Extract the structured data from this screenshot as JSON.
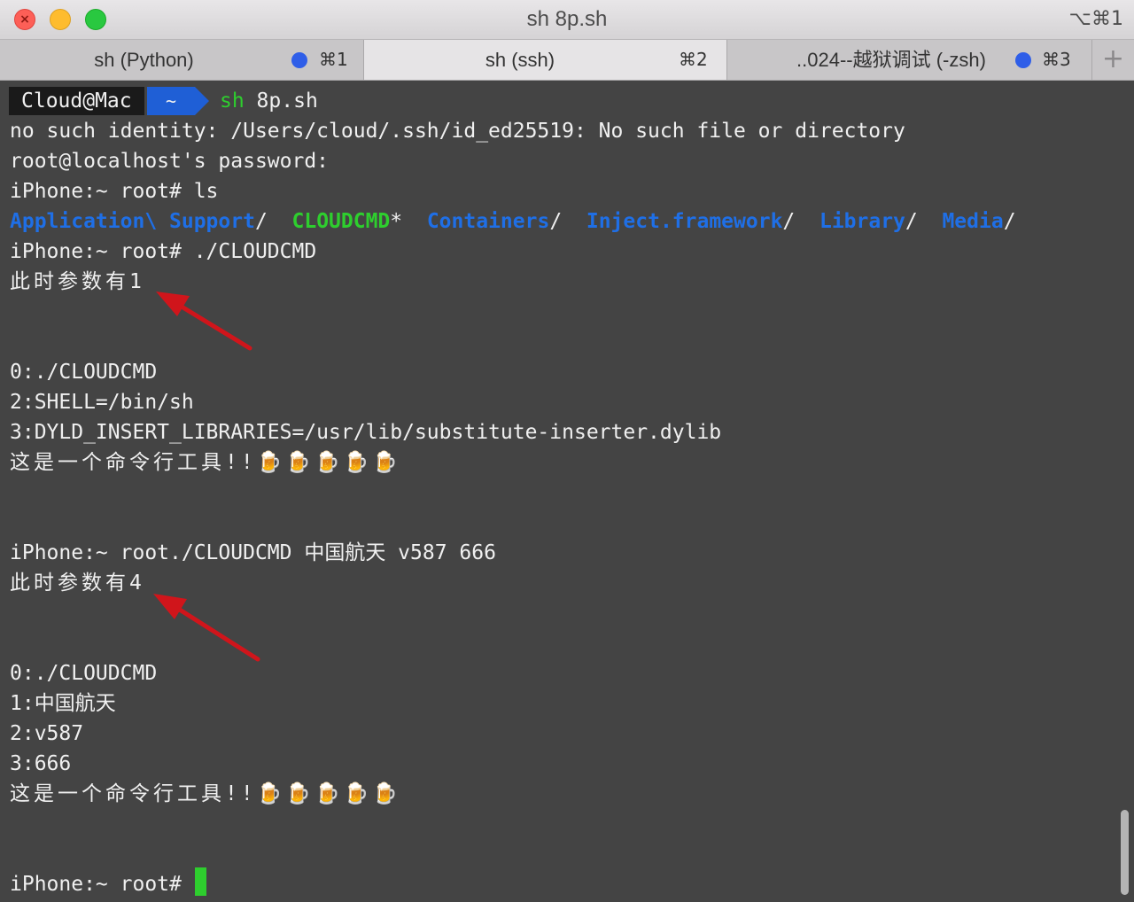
{
  "window": {
    "title": "sh 8p.sh",
    "shortcut": "⌥⌘1",
    "close_glyph": "×"
  },
  "tabs": [
    {
      "label": "sh (Python)",
      "shortcut": "⌘1",
      "has_dot": true,
      "active": false
    },
    {
      "label": "sh (ssh)",
      "shortcut": "⌘2",
      "has_dot": false,
      "active": true
    },
    {
      "label": "..024--越狱调试 (-zsh)",
      "shortcut": "⌘3",
      "has_dot": true,
      "active": false
    }
  ],
  "new_tab_glyph": "+",
  "prompt": {
    "user": "Cloud@Mac",
    "dir": "~",
    "cmd_name": "sh",
    "cmd_args": " 8p.sh"
  },
  "lines": {
    "l2": "no such identity: /Users/cloud/.ssh/id_ed25519: No such file or directory",
    "l3": "root@localhost's password:",
    "l4": "iPhone:~ root# ls",
    "ls": {
      "d1": "Application\\ Support",
      "s1": "/  ",
      "exe": "CLOUDCMD",
      "s2": "*  ",
      "d2": "Containers",
      "s3": "/  ",
      "d3": "Inject.framework",
      "s4": "/  ",
      "d4": "Library",
      "s5": "/  ",
      "d5": "Media",
      "s6": "/"
    },
    "l6": "iPhone:~ root# ./CLOUDCMD",
    "l7": "此时参数有1",
    "l8": "0:./CLOUDCMD",
    "l9": "2:SHELL=/bin/sh",
    "l10": "3:DYLD_INSERT_LIBRARIES=/usr/lib/substitute-inserter.dylib",
    "l11": "这是一个命令行工具!!🍺🍺🍺🍺🍺",
    "l12": "iPhone:~ root./CLOUDCMD 中国航天 v587 666",
    "l13": "此时参数有4",
    "l14": "0:./CLOUDCMD",
    "l15": "1:中国航天",
    "l16": "2:v587",
    "l17": "3:666",
    "l18": "这是一个命令行工具!!🍺🍺🍺🍺🍺",
    "l19": "iPhone:~ root# "
  },
  "colors": {
    "background": "#444444",
    "text": "#f0f0f0",
    "directory": "#1f6fe6",
    "executable": "#2ece2e",
    "annotation_arrow": "#d0151b"
  }
}
